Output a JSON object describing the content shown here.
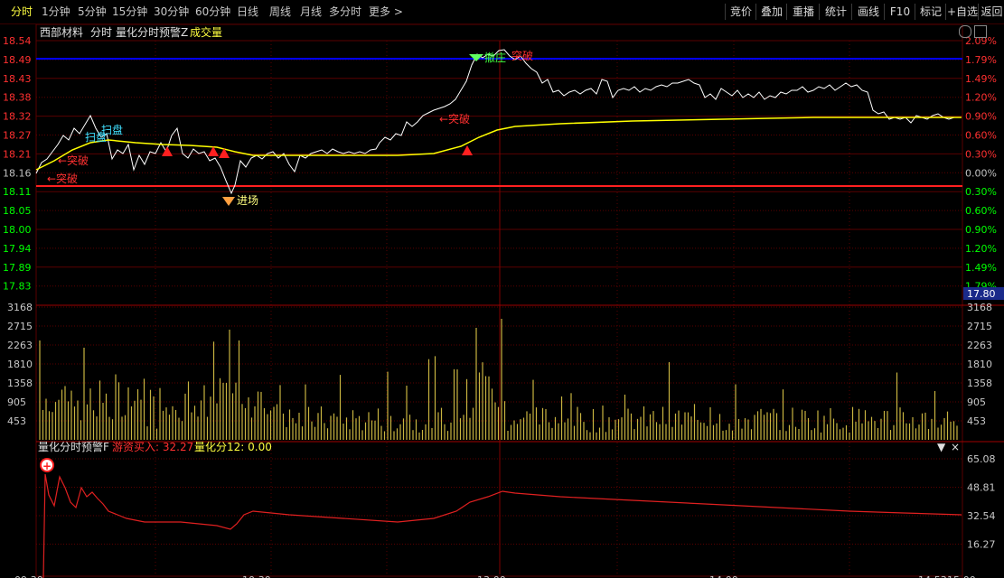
{
  "tabs": [
    {
      "label": "分时",
      "active": true
    },
    {
      "label": "1分钟"
    },
    {
      "label": "5分钟"
    },
    {
      "label": "15分钟"
    },
    {
      "label": "30分钟"
    },
    {
      "label": "60分钟"
    },
    {
      "label": "日线"
    },
    {
      "label": "周线"
    },
    {
      "label": "月线"
    },
    {
      "label": "多分时"
    },
    {
      "label": "更多"
    }
  ],
  "right_buttons": [
    "竞价",
    "叠加",
    "重播",
    "统计",
    "画线",
    "F10",
    "标记",
    "+自选",
    "返回"
  ],
  "header": {
    "stock": "西部材料",
    "mode": "分时",
    "indicator": "量化分时预警Z",
    "volume_label": "成交量"
  },
  "price_axis": {
    "left": [
      "18.54",
      "18.49",
      "18.43",
      "18.38",
      "18.32",
      "18.27",
      "18.21",
      "18.16",
      "18.11",
      "18.05",
      "18.00",
      "17.94",
      "17.89",
      "17.83"
    ],
    "right": [
      "2.09%",
      "1.79%",
      "1.49%",
      "1.20%",
      "0.90%",
      "0.60%",
      "0.30%",
      "0.00%",
      "0.30%",
      "0.60%",
      "0.90%",
      "1.20%",
      "1.49%",
      "1.79%"
    ],
    "current_price": "17.80"
  },
  "volume_axis": [
    "3168",
    "2715",
    "2263",
    "1810",
    "1358",
    "905",
    "453"
  ],
  "lower_panel": {
    "title": "量化分时预警F",
    "v1_label": "游资买入: 32.27",
    "v2_label": "量化分12: 0.00",
    "axis": [
      "65.08",
      "48.81",
      "32.54",
      "16.27"
    ]
  },
  "annotations": {
    "sweep": "扫盘",
    "break": "突破",
    "break_left": "←突破",
    "enter": "进场",
    "escape": "撤庄",
    "break_right": "突破"
  },
  "time_axis": [
    "09:30",
    "10:30",
    "13:00",
    "14:00",
    "14:53",
    "15:00"
  ],
  "colors": {
    "price": "#ffffff",
    "avg": "#ffff00",
    "vol": "#c8b440",
    "grid": "#5a0000",
    "up": "#ff3030",
    "down": "#00ff00",
    "blue": "#0000ff"
  }
}
